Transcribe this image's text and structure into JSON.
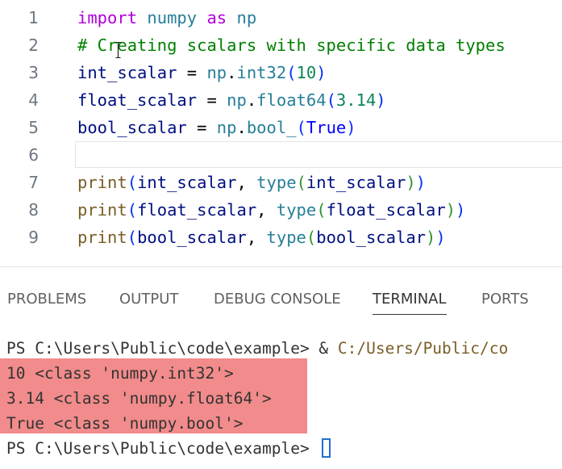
{
  "editor": {
    "line_numbers": [
      "1",
      "2",
      "3",
      "4",
      "5",
      "6",
      "7",
      "8",
      "9"
    ],
    "lines": [
      [
        {
          "t": "import",
          "c": "kw"
        },
        {
          "t": " numpy ",
          "c": "mod"
        },
        {
          "t": "as",
          "c": "kw"
        },
        {
          "t": " np",
          "c": "mod"
        }
      ],
      [
        {
          "t": "# Creating scalars with specific data types",
          "c": "cm"
        }
      ],
      [
        {
          "t": "int_scalar",
          "c": "var"
        },
        {
          "t": " = ",
          "c": "op"
        },
        {
          "t": "np",
          "c": "mod"
        },
        {
          "t": ".",
          "c": "op"
        },
        {
          "t": "int32",
          "c": "mod"
        },
        {
          "t": "(",
          "c": "pn1"
        },
        {
          "t": "10",
          "c": "num"
        },
        {
          "t": ")",
          "c": "pn1"
        }
      ],
      [
        {
          "t": "float_scalar",
          "c": "var"
        },
        {
          "t": " = ",
          "c": "op"
        },
        {
          "t": "np",
          "c": "mod"
        },
        {
          "t": ".",
          "c": "op"
        },
        {
          "t": "float64",
          "c": "mod"
        },
        {
          "t": "(",
          "c": "pn1"
        },
        {
          "t": "3.14",
          "c": "num"
        },
        {
          "t": ")",
          "c": "pn1"
        }
      ],
      [
        {
          "t": "bool_scalar",
          "c": "var"
        },
        {
          "t": " = ",
          "c": "op"
        },
        {
          "t": "np",
          "c": "mod"
        },
        {
          "t": ".",
          "c": "op"
        },
        {
          "t": "bool_",
          "c": "mod"
        },
        {
          "t": "(",
          "c": "pn1"
        },
        {
          "t": "True",
          "c": "cst"
        },
        {
          "t": ")",
          "c": "pn1"
        }
      ],
      [],
      [
        {
          "t": "print",
          "c": "fn"
        },
        {
          "t": "(",
          "c": "pn1"
        },
        {
          "t": "int_scalar",
          "c": "var"
        },
        {
          "t": ", ",
          "c": "op"
        },
        {
          "t": "type",
          "c": "mod"
        },
        {
          "t": "(",
          "c": "pn2"
        },
        {
          "t": "int_scalar",
          "c": "var"
        },
        {
          "t": ")",
          "c": "pn2"
        },
        {
          "t": ")",
          "c": "pn1"
        }
      ],
      [
        {
          "t": "print",
          "c": "fn"
        },
        {
          "t": "(",
          "c": "pn1"
        },
        {
          "t": "float_scalar",
          "c": "var"
        },
        {
          "t": ", ",
          "c": "op"
        },
        {
          "t": "type",
          "c": "mod"
        },
        {
          "t": "(",
          "c": "pn2"
        },
        {
          "t": "float_scalar",
          "c": "var"
        },
        {
          "t": ")",
          "c": "pn2"
        },
        {
          "t": ")",
          "c": "pn1"
        }
      ],
      [
        {
          "t": "print",
          "c": "fn"
        },
        {
          "t": "(",
          "c": "pn1"
        },
        {
          "t": "bool_scalar",
          "c": "var"
        },
        {
          "t": ", ",
          "c": "op"
        },
        {
          "t": "type",
          "c": "mod"
        },
        {
          "t": "(",
          "c": "pn2"
        },
        {
          "t": "bool_scalar",
          "c": "var"
        },
        {
          "t": ")",
          "c": "pn2"
        },
        {
          "t": ")",
          "c": "pn1"
        }
      ]
    ],
    "current_line": 6
  },
  "panel": {
    "tabs": [
      {
        "id": "problems",
        "label": "PROBLEMS",
        "active": false
      },
      {
        "id": "output",
        "label": "OUTPUT",
        "active": false
      },
      {
        "id": "debug-console",
        "label": "DEBUG CONSOLE",
        "active": false
      },
      {
        "id": "terminal",
        "label": "TERMINAL",
        "active": true
      },
      {
        "id": "ports",
        "label": "PORTS",
        "active": false
      }
    ]
  },
  "terminal": {
    "command_prompt": "PS C:\\Users\\Public\\code\\example> & ",
    "command_path": "C:/Users/Public/co",
    "output_lines": [
      "10 <class 'numpy.int32'>",
      "3.14 <class 'numpy.float64'>",
      "True <class 'numpy.bool'>"
    ],
    "final_prompt": "PS C:\\Users\\Public\\code\\example> "
  }
}
